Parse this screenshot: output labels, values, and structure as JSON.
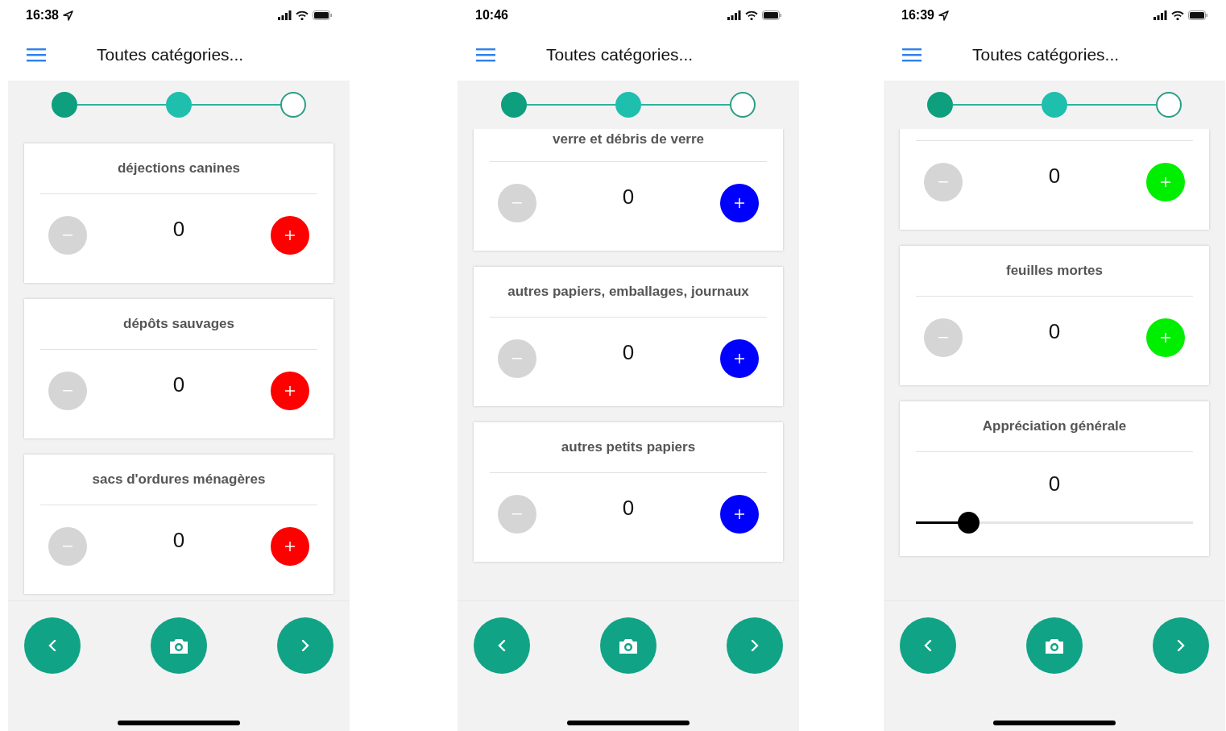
{
  "phones": [
    {
      "status_bar": {
        "time": "16:38",
        "location": true
      },
      "header": {
        "title": "Toutes catégories..."
      },
      "steps": [
        {
          "done": true,
          "selected": false
        },
        {
          "done": false,
          "selected": true
        },
        {
          "done": false,
          "selected": false
        }
      ],
      "cards": [
        {
          "kind": "counter",
          "title": "déjections canines",
          "value": "0",
          "minus_disabled": true,
          "color": "#ff0000"
        },
        {
          "kind": "counter",
          "title": "dépôts sauvages",
          "value": "0",
          "minus_disabled": true,
          "color": "#ff0000"
        },
        {
          "kind": "counter",
          "title": "sacs d'ordures ménagères",
          "value": "0",
          "minus_disabled": true,
          "color": "#ff0000"
        }
      ]
    },
    {
      "status_bar": {
        "time": "10:46",
        "location": false
      },
      "header": {
        "title": "Toutes catégories..."
      },
      "steps": [
        {
          "done": true,
          "selected": false
        },
        {
          "done": false,
          "selected": true
        },
        {
          "done": false,
          "selected": false
        }
      ],
      "cards": [
        {
          "kind": "counter",
          "title": "verre et débris de verre",
          "cut_top": true,
          "value": "0",
          "minus_disabled": true,
          "color": "#0000ff"
        },
        {
          "kind": "counter",
          "title": "autres papiers, emballages, journaux",
          "value": "0",
          "minus_disabled": true,
          "color": "#0000ff"
        },
        {
          "kind": "counter",
          "title": "autres petits papiers",
          "value": "0",
          "minus_disabled": true,
          "color": "#0000ff"
        }
      ]
    },
    {
      "status_bar": {
        "time": "16:39",
        "location": true
      },
      "header": {
        "title": "Toutes catégories..."
      },
      "steps": [
        {
          "done": true,
          "selected": false
        },
        {
          "done": false,
          "selected": true
        },
        {
          "done": false,
          "selected": false
        }
      ],
      "cards": [
        {
          "kind": "counter",
          "value": "0",
          "minus_disabled": true,
          "color": "#00ee00"
        },
        {
          "kind": "counter",
          "title": "feuilles mortes",
          "value": "0",
          "minus_disabled": true,
          "color": "#00ee00"
        },
        {
          "kind": "slider",
          "title": "Appréciation générale",
          "value": "0",
          "level": 0.19
        }
      ]
    }
  ]
}
